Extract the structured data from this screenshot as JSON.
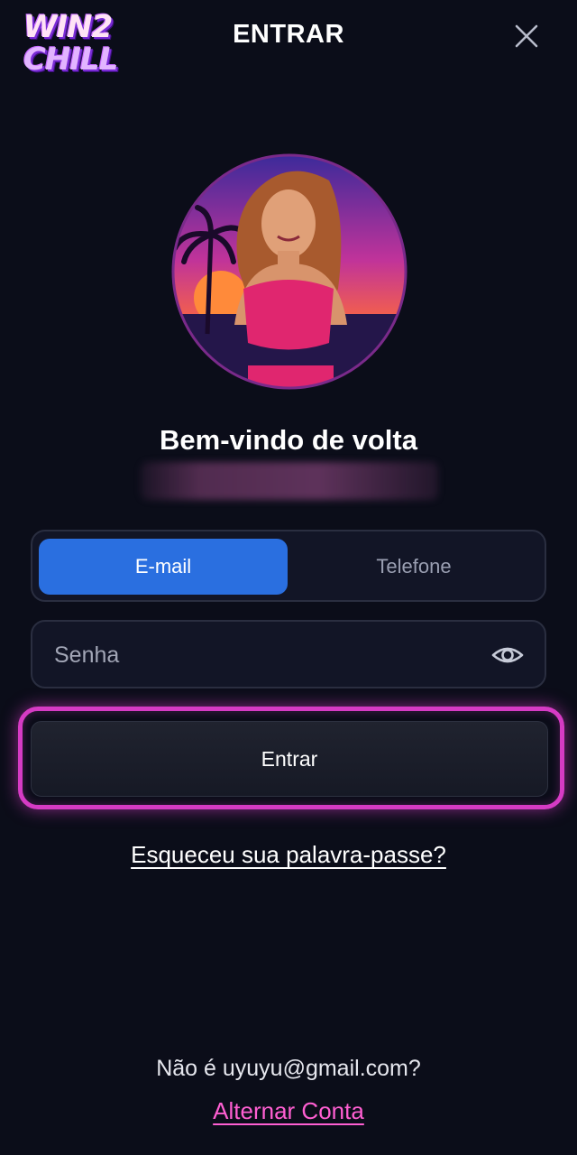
{
  "header": {
    "logo_line1": "WIN2",
    "logo_line2": "CHILL",
    "title": "ENTRAR",
    "close_icon": "close-icon"
  },
  "avatar": {
    "icon": "avatar-illustration"
  },
  "welcome": {
    "heading": "Bem-vindo de volta"
  },
  "login_tabs": {
    "items": [
      {
        "label": "E-mail",
        "active": true
      },
      {
        "label": "Telefone",
        "active": false
      }
    ]
  },
  "password": {
    "placeholder": "Senha",
    "value": "",
    "toggle_icon": "eye-icon"
  },
  "submit": {
    "label": "Entrar"
  },
  "forgot": {
    "label": "Esqueceu sua palavra-passe?"
  },
  "account": {
    "not_you": "Não é uyuyu@gmail.com?",
    "switch_label": "Alternar Conta"
  },
  "colors": {
    "background": "#0b0d19",
    "accent": "#2a6fe0",
    "highlight": "#d63bc4",
    "link_pink": "#ff5fd2"
  }
}
